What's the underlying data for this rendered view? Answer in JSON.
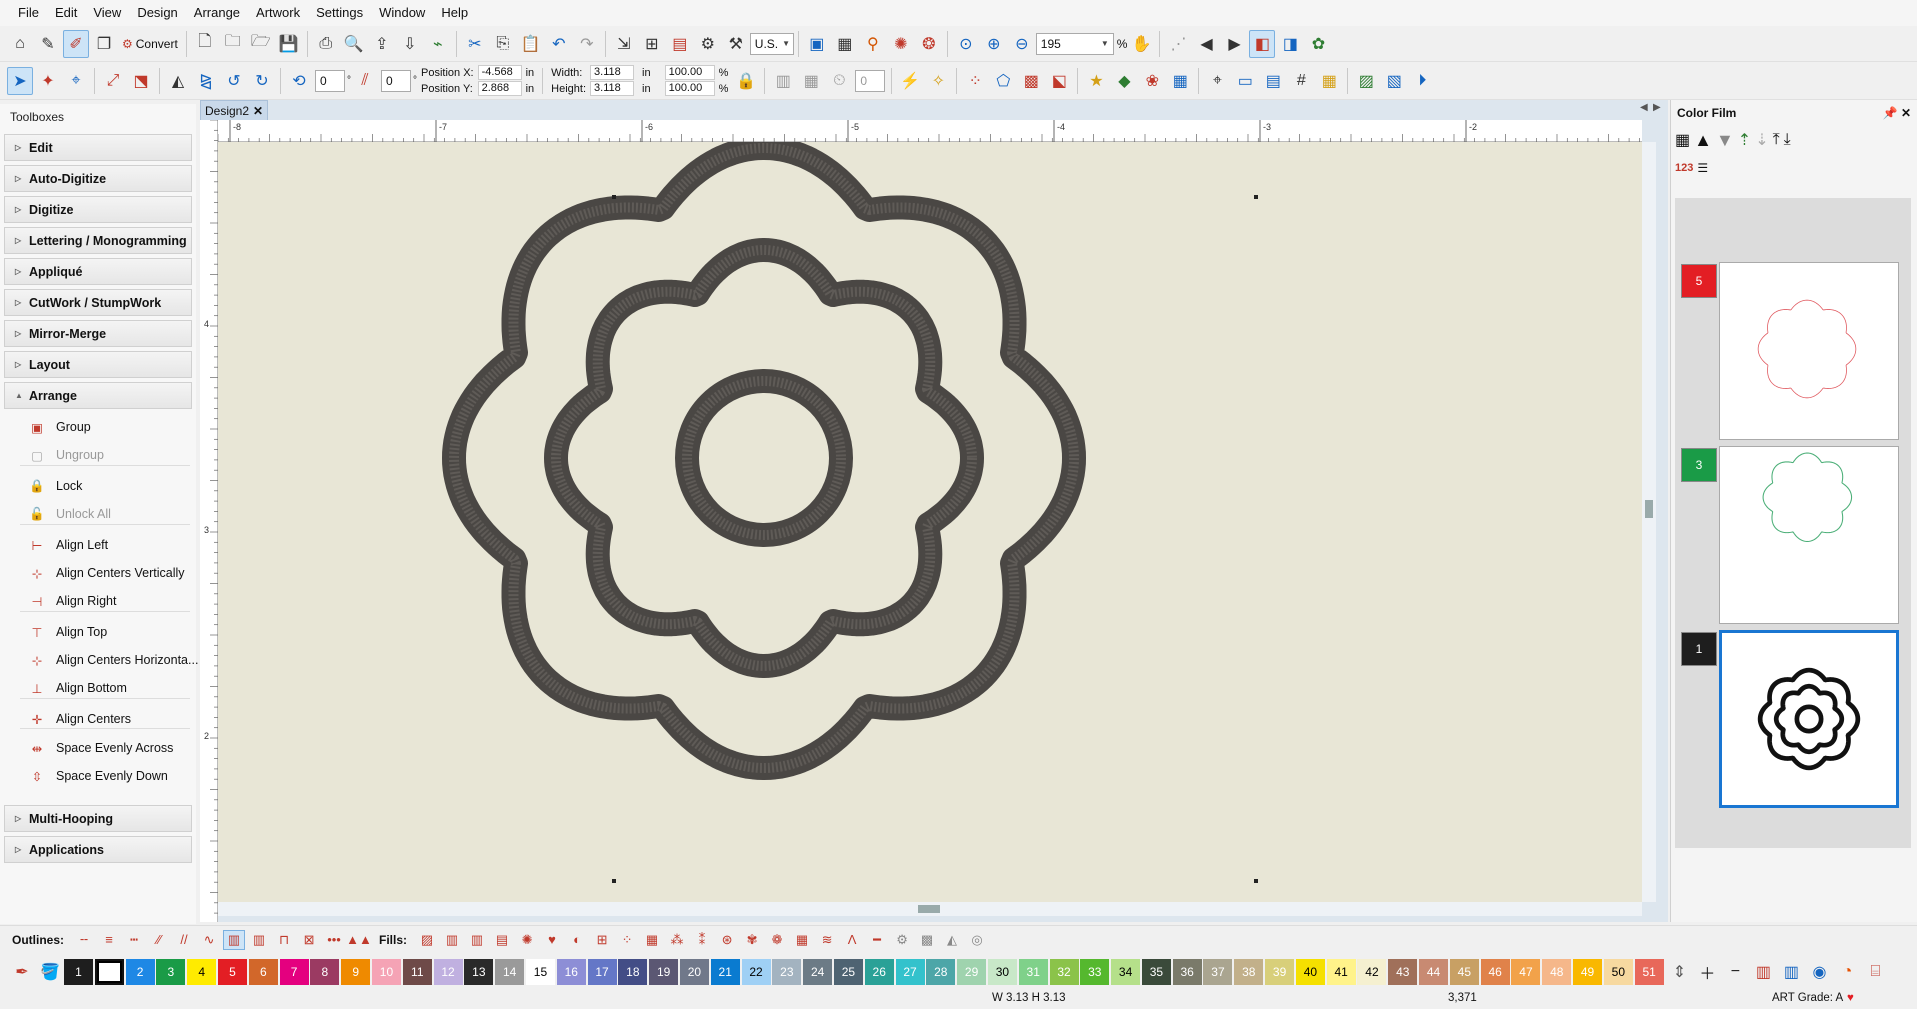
{
  "menu": [
    "File",
    "Edit",
    "View",
    "Design",
    "Arrange",
    "Artwork",
    "Settings",
    "Window",
    "Help"
  ],
  "toolbar1": {
    "convert_label": "Convert",
    "units": "U.S.",
    "zoom": "195",
    "zoom_unit": "%"
  },
  "toolbar2": {
    "rot1": "0",
    "rot2": "0",
    "pos_x_label": "Position X:",
    "pos_x": "-4.568",
    "pos_y_label": "Position Y:",
    "pos_y": "2.868",
    "unit": "in",
    "width_label": "Width:",
    "width": "3.118",
    "height_label": "Height:",
    "height": "3.118",
    "scale_w": "100.00",
    "scale_h": "100.00",
    "pct": "%",
    "stitch_count": "0"
  },
  "toolboxes": {
    "title": "Toolboxes",
    "groups_top": [
      "Edit",
      "Auto-Digitize",
      "Digitize",
      "Lettering / Monogramming",
      "Appliqué",
      "CutWork / StumpWork",
      "Mirror-Merge",
      "Layout",
      "Arrange"
    ],
    "arrange_items": [
      {
        "label": "Group",
        "disabled": false
      },
      {
        "label": "Ungroup",
        "disabled": true
      },
      {
        "label": "Lock",
        "disabled": false
      },
      {
        "label": "Unlock All",
        "disabled": true
      },
      {
        "label": "Align Left",
        "disabled": false
      },
      {
        "label": "Align Centers Vertically",
        "disabled": false
      },
      {
        "label": "Align Right",
        "disabled": false
      },
      {
        "label": "Align Top",
        "disabled": false
      },
      {
        "label": "Align Centers Horizonta...",
        "disabled": false
      },
      {
        "label": "Align Bottom",
        "disabled": false
      },
      {
        "label": "Align Centers",
        "disabled": false
      },
      {
        "label": "Space Evenly Across",
        "disabled": false
      },
      {
        "label": "Space Evenly Down",
        "disabled": false
      }
    ],
    "groups_bottom": [
      "Multi-Hooping",
      "Applications"
    ]
  },
  "document": {
    "tab": "Design2",
    "ruler_h": [
      "-8",
      "-7",
      "-6",
      "-5",
      "-4",
      "-3",
      "-2"
    ],
    "ruler_v": [
      "4",
      "3",
      "2"
    ]
  },
  "color_film": {
    "title": "Color Film",
    "numbering": "123",
    "entries": [
      {
        "num": "5",
        "color": "#e31e24",
        "outline": "#e05a60"
      },
      {
        "num": "3",
        "color": "#1a9b47",
        "outline": "#4caf78"
      },
      {
        "num": "1",
        "color": "#1e1e1e",
        "outline": "#111111"
      }
    ]
  },
  "outlines_label": "Outlines:",
  "fills_label": "Fills:",
  "palette": [
    {
      "n": "1",
      "bg": "#1e1e1e",
      "fg": "#ffffff"
    },
    {
      "n": "",
      "bg": "#111111",
      "fg": "#ffffff"
    },
    {
      "n": "2",
      "bg": "#1e88e5",
      "fg": "#ffffff"
    },
    {
      "n": "3",
      "bg": "#1a9b47",
      "fg": "#ffffff"
    },
    {
      "n": "4",
      "bg": "#ffeb00",
      "fg": "#000000"
    },
    {
      "n": "5",
      "bg": "#e31e24",
      "fg": "#ffffff"
    },
    {
      "n": "6",
      "bg": "#d2672a",
      "fg": "#ffffff"
    },
    {
      "n": "7",
      "bg": "#e4007f",
      "fg": "#ffffff"
    },
    {
      "n": "8",
      "bg": "#9b3a62",
      "fg": "#ffffff"
    },
    {
      "n": "9",
      "bg": "#ef8a00",
      "fg": "#ffffff"
    },
    {
      "n": "10",
      "bg": "#f5a3b5",
      "fg": "#ffffff"
    },
    {
      "n": "11",
      "bg": "#6e4a48",
      "fg": "#ffffff"
    },
    {
      "n": "12",
      "bg": "#c0b0e0",
      "fg": "#ffffff"
    },
    {
      "n": "13",
      "bg": "#2a2a2a",
      "fg": "#ffffff"
    },
    {
      "n": "14",
      "bg": "#9a9a9a",
      "fg": "#ffffff"
    },
    {
      "n": "15",
      "bg": "#ffffff",
      "fg": "#000000"
    },
    {
      "n": "16",
      "bg": "#8d8ed6",
      "fg": "#ffffff"
    },
    {
      "n": "17",
      "bg": "#6477c7",
      "fg": "#ffffff"
    },
    {
      "n": "18",
      "bg": "#434d86",
      "fg": "#ffffff"
    },
    {
      "n": "19",
      "bg": "#5b5773",
      "fg": "#ffffff"
    },
    {
      "n": "20",
      "bg": "#70788a",
      "fg": "#ffffff"
    },
    {
      "n": "21",
      "bg": "#0a7bd0",
      "fg": "#ffffff"
    },
    {
      "n": "22",
      "bg": "#9fd0f5",
      "fg": "#000000"
    },
    {
      "n": "23",
      "bg": "#a3b3c0",
      "fg": "#ffffff"
    },
    {
      "n": "24",
      "bg": "#6c7b86",
      "fg": "#ffffff"
    },
    {
      "n": "25",
      "bg": "#4e6372",
      "fg": "#ffffff"
    },
    {
      "n": "26",
      "bg": "#2aa197",
      "fg": "#ffffff"
    },
    {
      "n": "27",
      "bg": "#33c2cc",
      "fg": "#ffffff"
    },
    {
      "n": "28",
      "bg": "#4da6a8",
      "fg": "#ffffff"
    },
    {
      "n": "29",
      "bg": "#9fd3ae",
      "fg": "#ffffff"
    },
    {
      "n": "30",
      "bg": "#c8e8c8",
      "fg": "#000000"
    },
    {
      "n": "31",
      "bg": "#7fd18a",
      "fg": "#ffffff"
    },
    {
      "n": "32",
      "bg": "#8bc34a",
      "fg": "#ffffff"
    },
    {
      "n": "33",
      "bg": "#55b82e",
      "fg": "#ffffff"
    },
    {
      "n": "34",
      "bg": "#b5e08a",
      "fg": "#000000"
    },
    {
      "n": "35",
      "bg": "#3a4a3a",
      "fg": "#ffffff"
    },
    {
      "n": "36",
      "bg": "#7a7a6a",
      "fg": "#ffffff"
    },
    {
      "n": "37",
      "bg": "#aaa590",
      "fg": "#ffffff"
    },
    {
      "n": "38",
      "bg": "#c2b08a",
      "fg": "#ffffff"
    },
    {
      "n": "39",
      "bg": "#d8cf7a",
      "fg": "#ffffff"
    },
    {
      "n": "40",
      "bg": "#f5e000",
      "fg": "#000000"
    },
    {
      "n": "41",
      "bg": "#fff38a",
      "fg": "#000000"
    },
    {
      "n": "42",
      "bg": "#f5f0d0",
      "fg": "#000000"
    },
    {
      "n": "43",
      "bg": "#a0705a",
      "fg": "#ffffff"
    },
    {
      "n": "44",
      "bg": "#c88a72",
      "fg": "#ffffff"
    },
    {
      "n": "45",
      "bg": "#c8a064",
      "fg": "#ffffff"
    },
    {
      "n": "46",
      "bg": "#e0824a",
      "fg": "#ffffff"
    },
    {
      "n": "47",
      "bg": "#f2a24a",
      "fg": "#ffffff"
    },
    {
      "n": "48",
      "bg": "#f5b78a",
      "fg": "#ffffff"
    },
    {
      "n": "49",
      "bg": "#f9b800",
      "fg": "#ffffff"
    },
    {
      "n": "50",
      "bg": "#f7d9a0",
      "fg": "#000000"
    },
    {
      "n": "51",
      "bg": "#e8685a",
      "fg": "#ffffff"
    }
  ],
  "status": {
    "size": "W 3.13  H 3.13",
    "count": "3,371",
    "grade": "ART Grade: A",
    "heart_color": "#e31e24"
  }
}
